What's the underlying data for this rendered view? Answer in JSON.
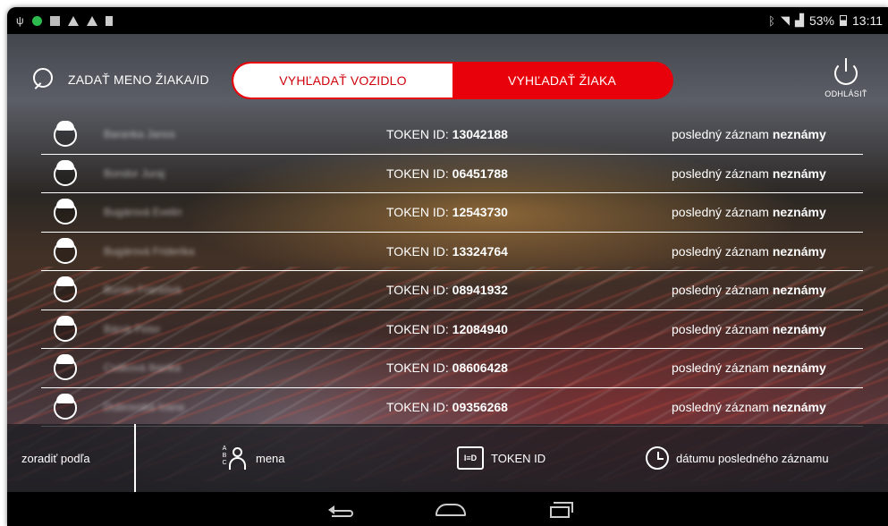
{
  "status_bar": {
    "battery": "53%",
    "time": "13:11",
    "left_icons": [
      "usb-icon",
      "status-dot-icon",
      "image-icon",
      "warning-icon",
      "warning-icon",
      "sdcard-icon"
    ],
    "right_icons": [
      "bluetooth-icon",
      "wifi-icon",
      "signal-icon",
      "battery-icon"
    ]
  },
  "header": {
    "search_label": "ZADAŤ MENO ŽIAKA/ID",
    "tabs": [
      {
        "label": "VYHĽADAŤ VOZIDLO",
        "active": false
      },
      {
        "label": "VYHĽADAŤ ŽIAKA",
        "active": true
      }
    ],
    "logout_label": "ODHLÁSIŤ"
  },
  "students": [
    {
      "name": "Baranka Janos",
      "token_label": "TOKEN ID: ",
      "token": "13042188",
      "record_label": "posledný záznam ",
      "record_state": "neznámy"
    },
    {
      "name": "Bondor Juraj",
      "token_label": "TOKEN ID: ",
      "token": "06451788",
      "record_label": "posledný záznam ",
      "record_state": "neznámy"
    },
    {
      "name": "Bugárová Evelin",
      "token_label": "TOKEN ID: ",
      "token": "12543730",
      "record_label": "posledný záznam ",
      "record_state": "neznámy"
    },
    {
      "name": "Bugárová Friderika",
      "token_label": "TOKEN ID: ",
      "token": "13324764",
      "record_label": "posledný záznam ",
      "record_state": "neznámy"
    },
    {
      "name": "Burián František",
      "token_label": "TOKEN ID: ",
      "token": "08941932",
      "record_label": "posledný záznam ",
      "record_state": "neznámy"
    },
    {
      "name": "Bárok Peter",
      "token_label": "TOKEN ID: ",
      "token": "12084940",
      "record_label": "posledný záznam ",
      "record_state": "neznámy"
    },
    {
      "name": "Csáková Ibanka",
      "token_label": "TOKEN ID: ",
      "token": "08606428",
      "record_label": "posledný záznam ",
      "record_state": "neznámy"
    },
    {
      "name": "Dubrovská Ivana",
      "token_label": "TOKEN ID: ",
      "token": "09356268",
      "record_label": "posledný záznam ",
      "record_state": "neznámy"
    }
  ],
  "sort_bar": {
    "title": "zoradiť podľa",
    "options": [
      {
        "label": "mena",
        "icon": "abc-person-icon"
      },
      {
        "label": "TOKEN ID",
        "icon": "id-book-icon"
      },
      {
        "label": "dátumu posledného záznamu",
        "icon": "clock-icon"
      }
    ],
    "abc_letters": "A\nB\nC",
    "id_book_text": "I≡D"
  },
  "nav_bar": {
    "buttons": [
      "back-icon",
      "home-icon",
      "recent-apps-icon"
    ]
  },
  "colors": {
    "accent": "#e8000b",
    "tab_inactive_bg": "#ffffff",
    "text": "#ffffff"
  }
}
